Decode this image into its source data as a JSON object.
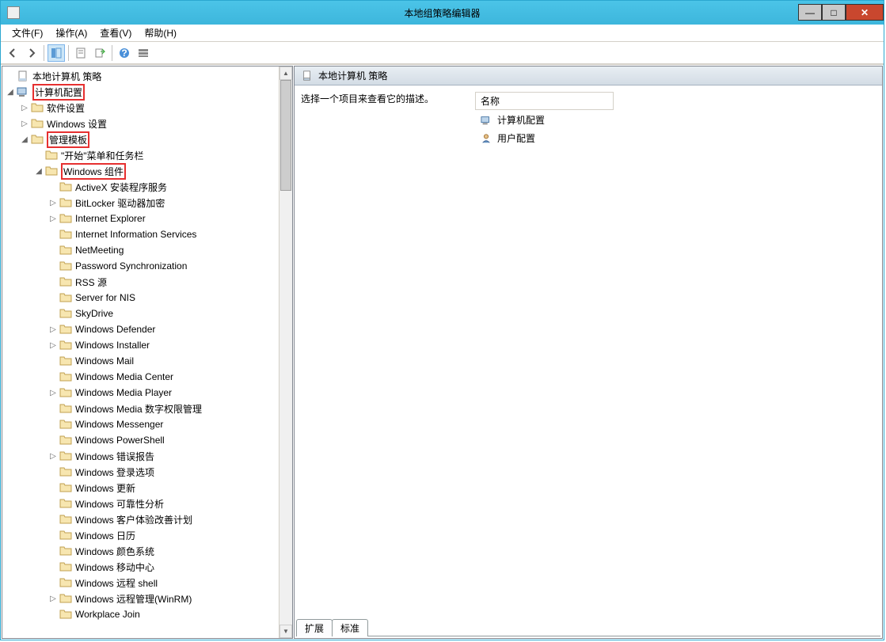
{
  "title": "本地组策略编辑器",
  "menubar": [
    "文件(F)",
    "操作(A)",
    "查看(V)",
    "帮助(H)"
  ],
  "tree": {
    "root": "本地计算机 策略",
    "computer_config": "计算机配置",
    "software_settings": "软件设置",
    "windows_settings": "Windows 设置",
    "admin_templates": "管理模板",
    "start_menu": "\"开始\"菜单和任务栏",
    "windows_components": "Windows 组件",
    "items": [
      "ActiveX 安装程序服务",
      "BitLocker 驱动器加密",
      "Internet Explorer",
      "Internet Information Services",
      "NetMeeting",
      "Password Synchronization",
      "RSS 源",
      "Server for NIS",
      "SkyDrive",
      "Windows Defender",
      "Windows Installer",
      "Windows Mail",
      "Windows Media Center",
      "Windows Media Player",
      "Windows Media 数字权限管理",
      "Windows Messenger",
      "Windows PowerShell",
      "Windows 错误报告",
      "Windows 登录选项",
      "Windows 更新",
      "Windows 可靠性分析",
      "Windows 客户体验改善计划",
      "Windows 日历",
      "Windows 颜色系统",
      "Windows 移动中心",
      "Windows 远程 shell",
      "Windows 远程管理(WinRM)",
      "Workplace Join"
    ],
    "expandable": [
      1,
      2,
      9,
      10,
      13,
      17,
      26
    ]
  },
  "right": {
    "header": "本地计算机 策略",
    "desc": "选择一个项目来查看它的描述。",
    "col": "名称",
    "rows": [
      "计算机配置",
      "用户配置"
    ],
    "tabs": [
      "扩展",
      "标准"
    ]
  }
}
